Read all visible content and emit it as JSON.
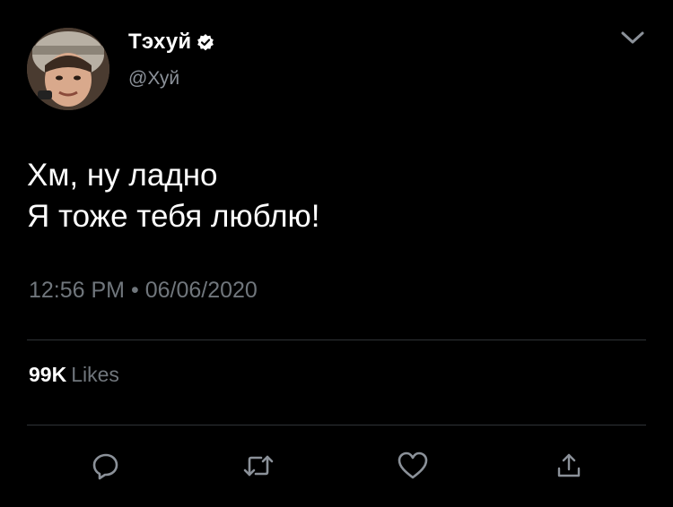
{
  "user": {
    "display_name": "Тэхуй",
    "handle": "@Хуй",
    "avatar_icon": "user-photo-avatar",
    "verified_icon": "verified-badge-icon"
  },
  "tweet": {
    "lines": [
      "Хм, ну ладно",
      "Я тоже тебя люблю!"
    ],
    "time": "12:56 PM",
    "separator": "•",
    "date": "06/06/2020"
  },
  "stats": {
    "likes_count": "99K",
    "likes_label": "Likes"
  },
  "actions": {
    "reply_icon": "reply-icon",
    "retweet_icon": "retweet-icon",
    "like_icon": "heart-icon",
    "share_icon": "share-icon",
    "menu_icon": "chevron-down-icon"
  },
  "colors": {
    "background": "#000000",
    "text_primary": "#ffffff",
    "text_secondary": "#70767c",
    "divider": "#2f3336",
    "icon": "#8b9199"
  }
}
